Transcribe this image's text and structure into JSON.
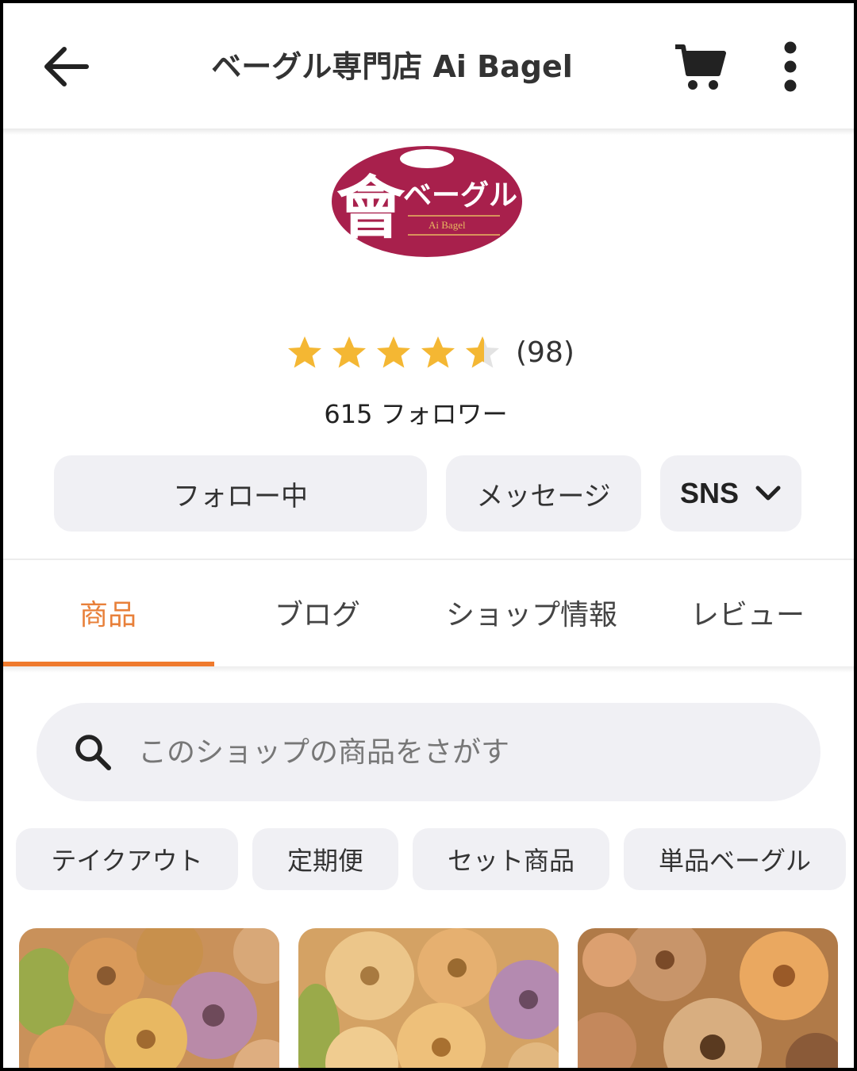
{
  "header": {
    "title": "ベーグル専門店 Ai Bagel",
    "back_icon": "arrow-left-icon",
    "cart_icon": "cart-icon",
    "more_icon": "more-vert-icon"
  },
  "shop": {
    "logo_text_main": "ベーグル",
    "logo_text_sub": "Ai Bagel",
    "logo_kanji": "會",
    "logo_color": "#a8204c",
    "rating_value": 4.5,
    "rating_count": "(98)",
    "followers": "615 フォロワー"
  },
  "actions": {
    "follow_label": "フォロー中",
    "message_label": "メッセージ",
    "sns_label": "SNS"
  },
  "tabs": [
    {
      "label": "商品",
      "active": true
    },
    {
      "label": "ブログ",
      "active": false
    },
    {
      "label": "ショップ情報",
      "active": false
    },
    {
      "label": "レビュー",
      "active": false
    }
  ],
  "search": {
    "placeholder": "このショップの商品をさがす",
    "value": ""
  },
  "categories": [
    "テイクアウト",
    "定期便",
    "セット商品",
    "単品ベーグル"
  ],
  "colors": {
    "accent": "#ef7a2d",
    "star": "#f4b733",
    "chip_bg": "#f0f0f4"
  }
}
